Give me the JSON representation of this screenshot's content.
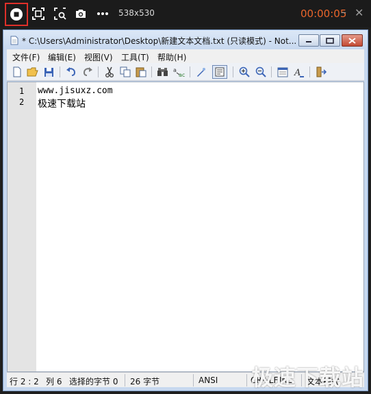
{
  "recorder": {
    "resolution": "538x530",
    "elapsed": "00:00:05",
    "minimize": "–",
    "close": "✕",
    "icons": [
      "stop-icon",
      "fullscreen-icon",
      "region-select-icon",
      "camera-icon",
      "more-icon"
    ]
  },
  "window": {
    "title": "* C:\\Users\\Administrator\\Desktop\\新建文本文档.txt (只读模式) - Not..."
  },
  "menu": {
    "items": [
      "文件(F)",
      "编辑(E)",
      "视图(V)",
      "工具(T)",
      "帮助(H)"
    ]
  },
  "toolbar": {
    "icons": [
      "new-icon",
      "open-icon",
      "save-icon",
      "undo-icon",
      "redo-icon",
      "cut-icon",
      "copy-icon",
      "paste-icon",
      "find-icon",
      "replace-icon",
      "marker-icon",
      "wordwrap-icon",
      "zoom-in-icon",
      "zoom-out-icon",
      "schemes-icon",
      "font-icon",
      "settings-icon"
    ]
  },
  "editor": {
    "lines": [
      {
        "number": "1",
        "text": "www.jisuxz.com"
      },
      {
        "number": "2",
        "text": "极速下载站"
      }
    ]
  },
  "status": {
    "position": "行 2 : 2",
    "column": "列 6",
    "selected": "选择的字节 0",
    "bytes": "26 字节",
    "encoding": "ANSI",
    "line_ending": "CR+LF",
    "mode": "INS",
    "mode2": "文本模式"
  },
  "watermark": "极速下载站",
  "colors": {
    "accent_timer": "#e9652b",
    "stop_border": "#e0302a"
  }
}
